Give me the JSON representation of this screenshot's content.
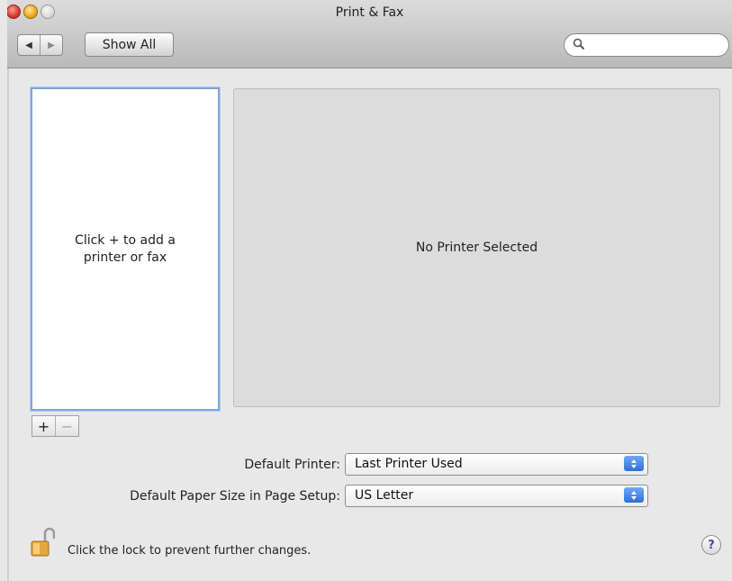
{
  "window": {
    "title": "Print & Fax"
  },
  "toolbar": {
    "back_icon": "left-triangle-icon",
    "forward_icon": "right-triangle-icon",
    "show_all_label": "Show All",
    "search_placeholder": "",
    "search_value": ""
  },
  "printer_list": {
    "empty_hint": "Click + to add a printer or fax"
  },
  "detail": {
    "message": "No Printer Selected"
  },
  "list_controls": {
    "add_label": "+",
    "remove_label": "−"
  },
  "settings": {
    "default_printer_label": "Default Printer:",
    "default_printer_value": "Last Printer Used",
    "default_paper_label": "Default Paper Size in Page Setup:",
    "default_paper_value": "US Letter"
  },
  "footer": {
    "lock_text": "Click the lock to prevent further changes.",
    "help_label": "?"
  },
  "colors": {
    "selection_border": "#7ea6dd",
    "popup_arrow": "#2e6fd6",
    "help_glyph": "#5b3bb0"
  }
}
